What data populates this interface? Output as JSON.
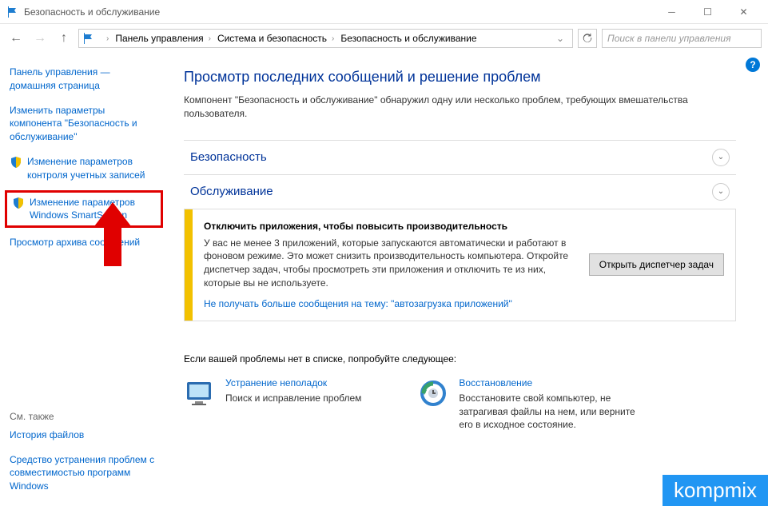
{
  "titlebar": {
    "title": "Безопасность и обслуживание"
  },
  "breadcrumb": {
    "items": [
      "Панель управления",
      "Система и безопасность",
      "Безопасность и обслуживание"
    ]
  },
  "search": {
    "placeholder": "Поиск в панели управления"
  },
  "sidebar": {
    "home": "Панель управления — домашняя страница",
    "links": [
      {
        "label": "Изменить параметры компонента \"Безопасность и обслуживание\"",
        "shield": false
      },
      {
        "label": "Изменение параметров контроля учетных записей",
        "shield": true
      },
      {
        "label": "Изменение параметров Windows SmartScreen",
        "shield": true,
        "highlight": true
      },
      {
        "label": "Просмотр архива сообщений",
        "shield": false
      }
    ],
    "see_also_head": "См. также",
    "see_also": [
      "История файлов",
      "Средство устранения проблем с совместимостью программ Windows"
    ]
  },
  "main": {
    "heading": "Просмотр последних сообщений и решение проблем",
    "subheading": "Компонент \"Безопасность и обслуживание\" обнаружил одну или несколько проблем, требующих вмешательства пользователя.",
    "sections": {
      "security": "Безопасность",
      "maintenance": "Обслуживание"
    },
    "alert": {
      "title": "Отключить приложения, чтобы повысить производительность",
      "desc": "У вас не менее 3 приложений, которые запускаются автоматически и работают в фоновом режиме. Это может снизить производительность компьютера. Откройте диспетчер задач, чтобы просмотреть эти приложения и отключить те из них, которые вы не используете.",
      "link": "Не получать больше сообщения на тему: \"автозагрузка приложений\"",
      "button": "Открыть диспетчер задач"
    },
    "footer": "Если вашей проблемы нет в списке, попробуйте следующее:",
    "solutions": [
      {
        "title": "Устранение неполадок",
        "desc": "Поиск и исправление проблем"
      },
      {
        "title": "Восстановление",
        "desc": "Восстановите свой компьютер, не затрагивая файлы на нем, или верните его в исходное состояние."
      }
    ]
  },
  "watermark": "kompmix"
}
